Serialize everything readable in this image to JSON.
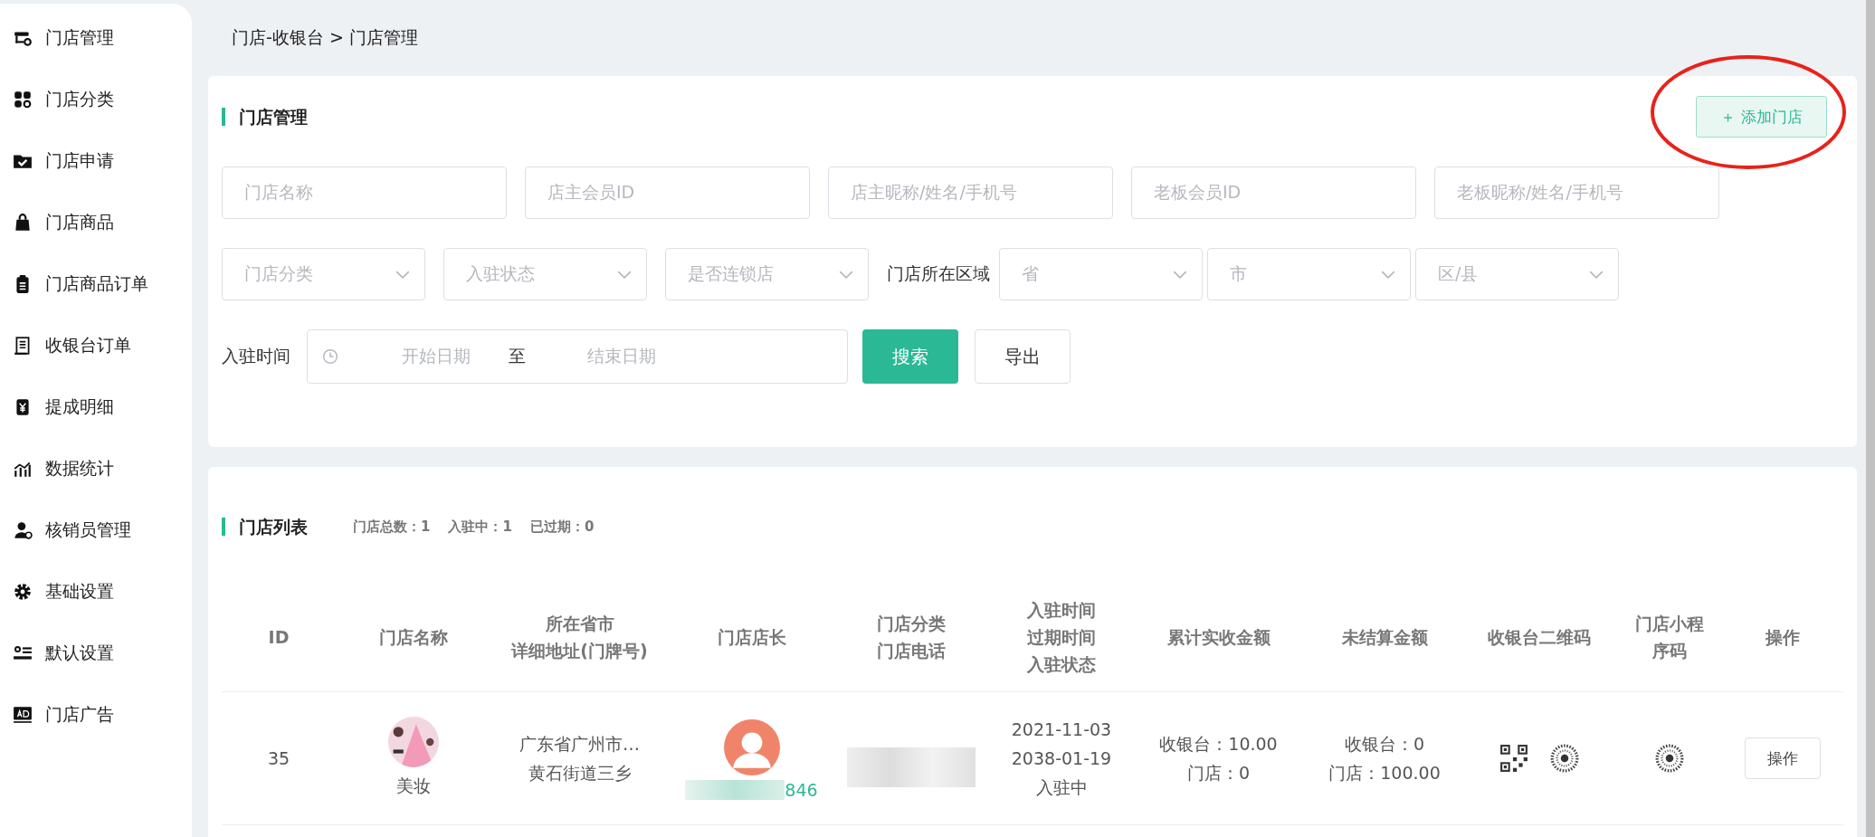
{
  "sidebar": {
    "items": [
      {
        "label": "门店管理"
      },
      {
        "label": "门店分类"
      },
      {
        "label": "门店申请"
      },
      {
        "label": "门店商品"
      },
      {
        "label": "门店商品订单"
      },
      {
        "label": "收银台订单"
      },
      {
        "label": "提成明细"
      },
      {
        "label": "数据统计"
      },
      {
        "label": "核销员管理"
      },
      {
        "label": "基础设置"
      },
      {
        "label": "默认设置"
      },
      {
        "label": "门店广告"
      }
    ]
  },
  "breadcrumb": "门店-收银台 > 门店管理",
  "filter_panel": {
    "title": "门店管理",
    "add_button": "＋ 添加门店",
    "text_fields": [
      {
        "placeholder": "门店名称"
      },
      {
        "placeholder": "店主会员ID"
      },
      {
        "placeholder": "店主昵称/姓名/手机号"
      },
      {
        "placeholder": "老板会员ID"
      },
      {
        "placeholder": "老板昵称/姓名/手机号"
      }
    ],
    "selects": [
      {
        "placeholder": "门店分类"
      },
      {
        "placeholder": "入驻状态"
      },
      {
        "placeholder": "是否连锁店"
      }
    ],
    "region_label": "门店所在区域",
    "region_selects": [
      {
        "placeholder": "省"
      },
      {
        "placeholder": "市"
      },
      {
        "placeholder": "区/县"
      }
    ],
    "date_label": "入驻时间",
    "date_start": "开始日期",
    "date_separator": "至",
    "date_end": "结束日期",
    "search_button": "搜索",
    "export_button": "导出"
  },
  "store_list": {
    "title": "门店列表",
    "stats": [
      "门店总数：1",
      "入驻中：1",
      "已过期：0"
    ],
    "columns": [
      [
        "ID"
      ],
      [
        "门店名称"
      ],
      [
        "所在省市",
        "详细地址(门牌号)"
      ],
      [
        "门店店长"
      ],
      [
        "门店分类",
        "门店电话"
      ],
      [
        "入驻时间",
        "过期时间",
        "入驻状态"
      ],
      [
        "累计实收金额"
      ],
      [
        "未结算金额"
      ],
      [
        "收银台二维码"
      ],
      [
        "门店小程",
        "序码"
      ],
      [
        "操作"
      ]
    ],
    "rows": [
      {
        "id": "35",
        "name": "美妆",
        "address": [
          "广东省广州市…",
          "黄石街道三乡"
        ],
        "phone": "846",
        "dates": [
          "2021-11-03",
          "2038-01-19",
          "入驻中"
        ],
        "received": [
          "收银台：10.00",
          "门店：0"
        ],
        "unsettled": [
          "收银台：0",
          "门店：100.00"
        ],
        "action": "操作"
      }
    ]
  }
}
